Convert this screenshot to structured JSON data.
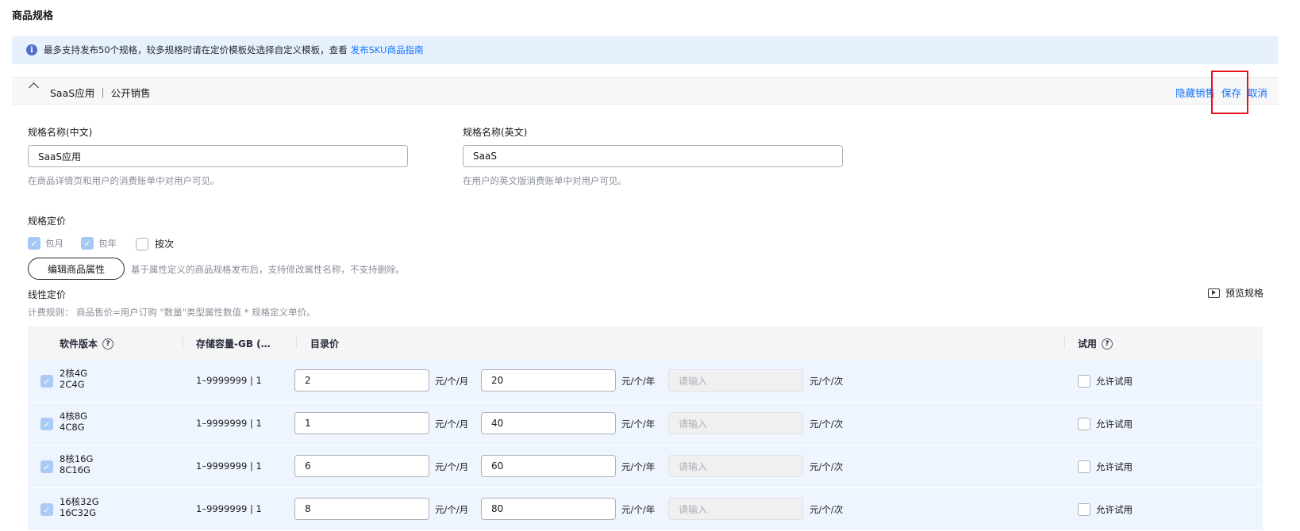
{
  "section_title": "商品规格",
  "notice": {
    "text": "最多支持发布50个规格，较多规格时请在定价模板处选择自定义模板，查看",
    "link": "发布SKU商品指南"
  },
  "spec_header": {
    "title": "SaaS应用 ｜ 公开销售",
    "actions": {
      "hide": "隐藏销售",
      "save": "保存",
      "cancel": "取消"
    }
  },
  "name_cn": {
    "label": "规格名称(中文)",
    "value": "SaaS应用",
    "hint": "在商品详情页和用户的消费账单中对用户可见。"
  },
  "name_en": {
    "label": "规格名称(英文)",
    "value": "SaaS",
    "hint": "在用户的英文版消费账单中对用户可见。"
  },
  "pricing": {
    "label": "规格定价",
    "options": [
      {
        "label": "包月",
        "checked": true,
        "disabled": true
      },
      {
        "label": "包年",
        "checked": true,
        "disabled": true
      },
      {
        "label": "按次",
        "checked": false,
        "disabled": false
      }
    ],
    "edit_button": "编辑商品属性",
    "edit_hint": "基于属性定义的商品规格发布后，支持修改属性名称，不支持删除。"
  },
  "linear": {
    "label": "线性定价",
    "preview": "预览规格",
    "rule": "计费规则：  商品售价=用户订购 \"数量\"类型属性数值 * 规格定义单价。"
  },
  "table": {
    "headers": {
      "version": "软件版本",
      "storage": "存储容量-GB (…",
      "price": "目录价",
      "trial": "试用"
    },
    "units": {
      "month": "元/个/月",
      "year": "元/个/年",
      "times": "元/个/次"
    },
    "placeholder": "请输入",
    "trial_label": "允许试用",
    "rows": [
      {
        "name1": "2核4G",
        "name2": "2C4G",
        "range": "1–9999999 | 1",
        "month": "2",
        "year": "20"
      },
      {
        "name1": "4核8G",
        "name2": "4C8G",
        "range": "1–9999999 | 1",
        "month": "1",
        "year": "40"
      },
      {
        "name1": "8核16G",
        "name2": "8C16G",
        "range": "1–9999999 | 1",
        "month": "6",
        "year": "60"
      },
      {
        "name1": "16核32G",
        "name2": "16C32G",
        "range": "1–9999999 | 1",
        "month": "8",
        "year": "80"
      }
    ]
  },
  "colors": {
    "accent": "#1476ff",
    "highlight": "#e5141b",
    "row_bg": "#eef5fe",
    "notice_bg": "#e6f1fd"
  }
}
